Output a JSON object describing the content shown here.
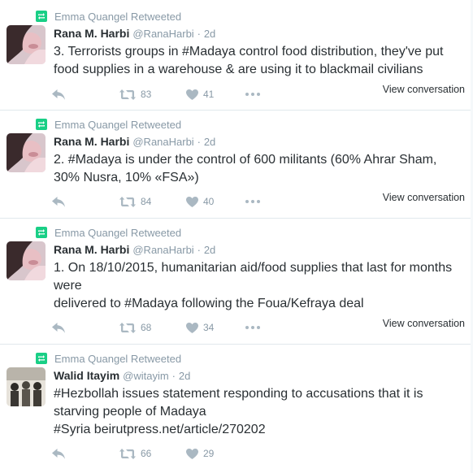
{
  "tweets": [
    {
      "retweeted_by": "Emma Quangel Retweeted",
      "name": "Rana M. Harbi",
      "handle": "@RanaHarbi",
      "time": "2d",
      "text_lines": [
        "3. Terrorists groups in #Madaya control food distribution, they've put",
        "food supplies in a warehouse & are using it to blackmail civilians"
      ],
      "retweets": "83",
      "likes": "41",
      "view_conversation": "View conversation"
    },
    {
      "retweeted_by": "Emma Quangel Retweeted",
      "name": "Rana M. Harbi",
      "handle": "@RanaHarbi",
      "time": "2d",
      "text_lines": [
        "2. #Madaya is under the control of 600 militants (60% Ahrar Sham,",
        "30% Nusra, 10% «FSA»)"
      ],
      "retweets": "84",
      "likes": "40",
      "view_conversation": "View conversation"
    },
    {
      "retweeted_by": "Emma Quangel Retweeted",
      "name": "Rana M. Harbi",
      "handle": "@RanaHarbi",
      "time": "2d",
      "text_lines": [
        "1. On 18/10/2015, humanitarian aid/food supplies that last for months",
        "were",
        "delivered to #Madaya following the Foua/Kefraya deal"
      ],
      "retweets": "68",
      "likes": "34",
      "view_conversation": "View conversation"
    },
    {
      "retweeted_by": "Emma Quangel Retweeted",
      "name": "Walid Itayim",
      "handle": "@witayim",
      "time": "2d",
      "text_lines": [
        "#Hezbollah issues statement responding to accusations that it is",
        "starving people of Madaya",
        "#Syria beirutpress.net/article/270202"
      ],
      "retweets": "66",
      "likes": "29",
      "view_conversation": ""
    }
  ],
  "dot_separator": "·",
  "colors": {
    "retweet_green": "#19cf86",
    "muted": "#8899a6",
    "text": "#292f33",
    "divider": "#e1e8ed"
  },
  "icons": [
    "retweet-icon",
    "reply-icon",
    "retweet-action-icon",
    "like-heart-icon",
    "more-dots-icon"
  ]
}
